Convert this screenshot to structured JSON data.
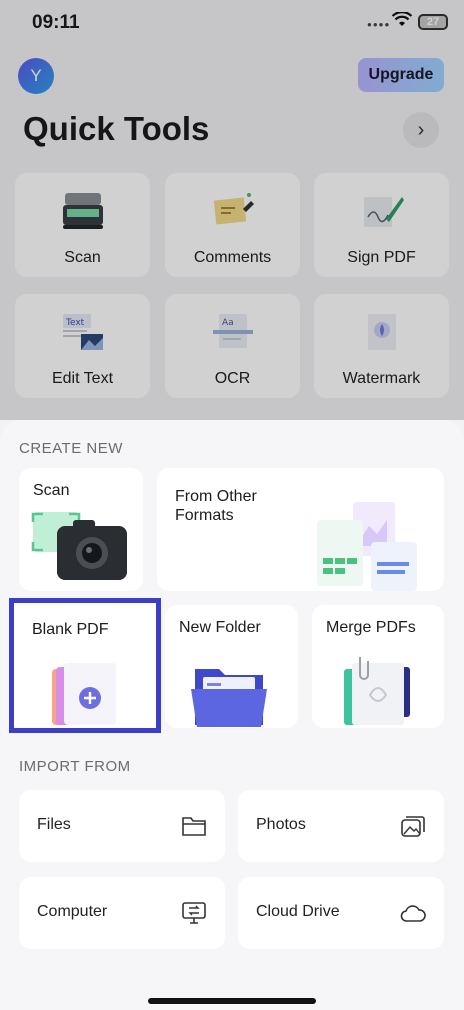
{
  "status": {
    "time": "09:11",
    "battery": "27"
  },
  "header": {
    "avatar_letter": "Y",
    "upgrade_label": "Upgrade",
    "title": "Quick Tools"
  },
  "tools": [
    {
      "label": "Scan",
      "icon": "scanner-icon"
    },
    {
      "label": "Comments",
      "icon": "sticky-note-icon"
    },
    {
      "label": "Sign PDF",
      "icon": "pen-sign-icon"
    },
    {
      "label": "Edit Text",
      "icon": "edit-text-icon"
    },
    {
      "label": "OCR",
      "icon": "ocr-icon"
    },
    {
      "label": "Watermark",
      "icon": "watermark-icon"
    }
  ],
  "create": {
    "heading": "CREATE NEW",
    "cards": [
      {
        "label": "Scan",
        "icon": "camera-icon"
      },
      {
        "label": "From Other Formats",
        "line1": "From Other",
        "line2": "Formats",
        "icon": "documents-icon"
      },
      {
        "label": "Blank PDF",
        "icon": "add-pdf-icon",
        "selected": true
      },
      {
        "label": "New Folder",
        "icon": "folder-icon"
      },
      {
        "label": "Merge PDFs",
        "icon": "merge-icon"
      }
    ]
  },
  "import": {
    "heading": "IMPORT FROM",
    "items": [
      {
        "label": "Files",
        "icon": "folder-outline-icon"
      },
      {
        "label": "Photos",
        "icon": "photos-icon"
      },
      {
        "label": "Computer",
        "icon": "computer-icon"
      },
      {
        "label": "Cloud Drive",
        "icon": "cloud-icon"
      }
    ]
  },
  "colors": {
    "accent": "#3b3fc8",
    "upgrade_start": "#b9b4ff",
    "upgrade_end": "#9ed2ff"
  }
}
